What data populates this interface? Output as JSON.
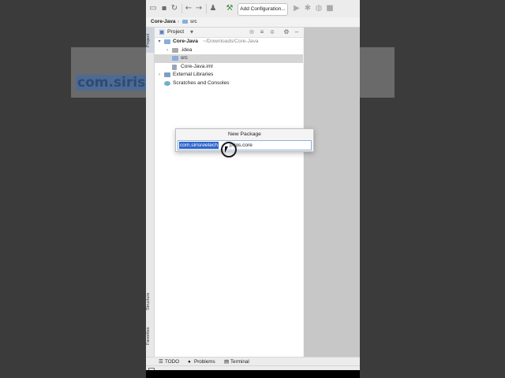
{
  "toolbar": {
    "config_label": "Add Configuration..."
  },
  "breadcrumb": {
    "project": "Core-Java",
    "folder": "src"
  },
  "side_tabs": {
    "project": "Project",
    "structure": "Structure",
    "favorites": "Favorites"
  },
  "panel": {
    "title": "Project"
  },
  "tree": {
    "root_label": "Core-Java",
    "root_hint": "~/Downloads/Core-Java",
    "items": [
      {
        "label": ".idea"
      },
      {
        "label": "src"
      },
      {
        "label": "Core-Java.iml"
      },
      {
        "label": "External Libraries"
      },
      {
        "label": "Scratches and Consoles"
      }
    ]
  },
  "bottom": {
    "todo": "TODO",
    "problems": "Problems",
    "terminal": "Terminal"
  },
  "dialog": {
    "title": "New Package",
    "input_selected": "com.sirisreetech",
    "input_rest": "prips.core"
  },
  "background": {
    "banner_text": "com.sirisree"
  }
}
